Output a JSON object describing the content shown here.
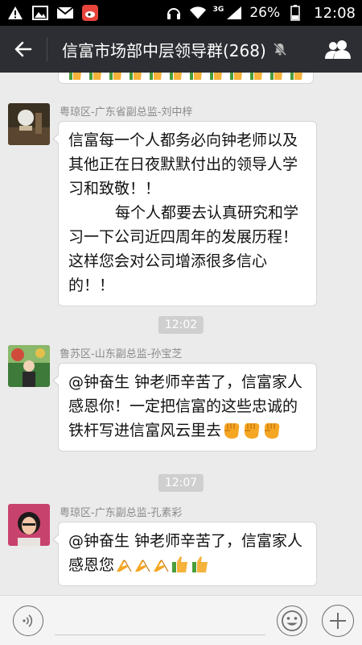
{
  "status_bar": {
    "network": "3G",
    "battery_percent": "26%",
    "time": "12:08",
    "icons": [
      "warning-icon",
      "image-icon",
      "mail-icon",
      "weibo-icon",
      "headphones-icon",
      "wifi-icon",
      "signal-icon",
      "battery-icon"
    ]
  },
  "header": {
    "title": "信富市场部中层领导群(268)",
    "icons": [
      "back-arrow-icon",
      "mute-icon",
      "group-members-icon"
    ]
  },
  "messages": [
    {
      "sender": "粤琼区-广东省副总监-刘中梓",
      "paragraphs": [
        "信富每一个人都务必向钟老师以及其他正在日夜默默付出的领导人学习和致敬！！",
        "每个人都要去认真研究和学习一下公司近四周年的发展历程！这样您会对公司增添很多信心的！！"
      ]
    },
    {
      "time": "12:02",
      "sender": "鲁苏区-山东副总监-孙宝芝",
      "text": "@钟奋生 钟老师辛苦了，信富家人感恩你！一定把信富的这些忠诚的铁杆写进信富风云里去",
      "emoji": [
        "fist-emoji",
        "fist-emoji",
        "fist-emoji"
      ]
    },
    {
      "time": "12:07",
      "sender": "粤琼区-广东副总监-孔素彩",
      "text": "@钟奋生 钟老师辛苦了，信富家人感恩您",
      "emoji": [
        "pray-emoji",
        "pray-emoji",
        "pray-emoji",
        "thumbs-up-emoji",
        "thumbs-up-emoji"
      ]
    }
  ],
  "input_bar": {
    "placeholder": "",
    "icons": [
      "voice-icon",
      "emoji-icon",
      "plus-icon"
    ]
  },
  "colors": {
    "app_bar": "#2c2e33",
    "chat_background": "#ebebeb",
    "bubble": "#ffffff",
    "time_pill": "#cfcfcf"
  }
}
